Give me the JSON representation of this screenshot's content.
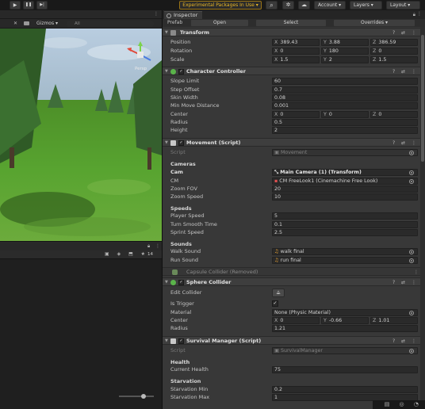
{
  "toolbar": {
    "play_icon": "▶",
    "pause_icon": "❚❚",
    "step_icon": "▶|",
    "experimental_label": "Experimental Packages In Use ▾",
    "search_icon": "⌕",
    "cloud_icon": "☁",
    "settings_icon": "✲",
    "account_label": "Account ▾",
    "layers_label": "Layers ▾",
    "layout_label": "Layout ▾"
  },
  "scene": {
    "gizmos_label": "Gizmos ▾",
    "search_placeholder": "All",
    "persp_label": "Persp",
    "toolbar_count": "14",
    "tools_icon": "✕",
    "tree_color": "#3f6e3a",
    "sky_color": "#a8c0d8",
    "grass_color": "#56a02e"
  },
  "inspector": {
    "tab_label": "Inspector",
    "prefab_label": "Prefab",
    "open_label": "Open",
    "select_label": "Select",
    "overrides_label": "Overrides ▾",
    "header_icons": "? ⇄ ⋮",
    "transform": {
      "title": "Transform",
      "position_label": "Position",
      "position": {
        "x": "389.43",
        "y": "3.88",
        "z": "386.59"
      },
      "rotation_label": "Rotation",
      "rotation": {
        "x": "0",
        "y": "180",
        "z": "0"
      },
      "scale_label": "Scale",
      "scale": {
        "x": "1.5",
        "y": "2",
        "z": "1.5"
      }
    },
    "character_controller": {
      "title": "Character Controller",
      "slope_limit_label": "Slope Limit",
      "slope_limit": "60",
      "step_offset_label": "Step Offset",
      "step_offset": "0.7",
      "skin_width_label": "Skin Width",
      "skin_width": "0.08",
      "min_move_label": "Min Move Distance",
      "min_move": "0.001",
      "center_label": "Center",
      "center": {
        "x": "0",
        "y": "0",
        "z": "0"
      },
      "radius_label": "Radius",
      "radius": "0.5",
      "height_label": "Height",
      "height": "2"
    },
    "movement": {
      "title": "Movement (Script)",
      "script_label": "Script",
      "script_value": "Movement",
      "cameras_header": "Cameras",
      "cam_label": "Cam",
      "cam_value": "Main Camera (1) (Transform)",
      "cm_label": "CM",
      "cm_value": "CM FreeLook1 (Cinemachine Free Look)",
      "zoom_fov_label": "Zoom FOV",
      "zoom_fov": "20",
      "zoom_speed_label": "Zoom Speed",
      "zoom_speed": "10",
      "speeds_header": "Speeds",
      "player_speed_label": "Player Speed",
      "player_speed": "5",
      "turn_smooth_label": "Turn Smooth Time",
      "turn_smooth": "0.1",
      "sprint_speed_label": "Sprint Speed",
      "sprint_speed": "2.5",
      "sounds_header": "Sounds",
      "walk_sound_label": "Walk Sound",
      "walk_sound": "walk final",
      "run_sound_label": "Run Sound",
      "run_sound": "run final"
    },
    "capsule_removed": {
      "title": "Capsule Collider (Removed)"
    },
    "sphere_collider": {
      "title": "Sphere Collider",
      "edit_collider_label": "Edit Collider",
      "is_trigger_label": "Is Trigger",
      "is_trigger_check": "✓",
      "material_label": "Material",
      "material_value": "None (Physic Material)",
      "center_label": "Center",
      "center": {
        "x": "0",
        "y": "-0.66",
        "z": "1.01"
      },
      "radius_label": "Radius",
      "radius": "1.21"
    },
    "survival_manager": {
      "title": "Survival Manager (Script)",
      "script_label": "Script",
      "script_value": "SurvivalManager",
      "health_header": "Health",
      "current_health_label": "Current Health",
      "current_health": "75",
      "starvation_header": "Starvation",
      "starvation_min_label": "Starvation Min",
      "starvation_min": "0.2",
      "starvation_max_label": "Starvation Max",
      "starvation_max": "1"
    }
  },
  "colors": {
    "panel_bg": "#383838",
    "warning_border": "#9a7416",
    "warning_text": "#e8b625"
  }
}
